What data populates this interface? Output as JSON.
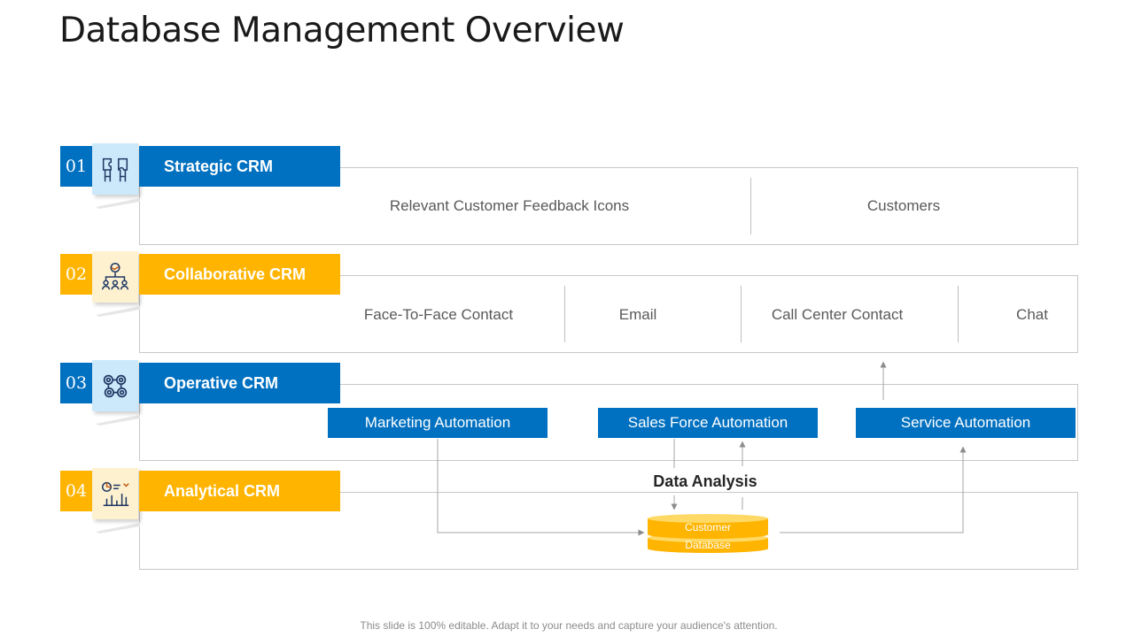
{
  "title": "Database Management Overview",
  "sections": [
    {
      "number": "01",
      "label": "Strategic CRM",
      "color": "#0070c0",
      "icon": "puzzle-people-icon"
    },
    {
      "number": "02",
      "label": "Collaborative  CRM",
      "color": "#ffb400",
      "icon": "team-handshake-icon"
    },
    {
      "number": "03",
      "label": "Operative CRM",
      "color": "#0070c0",
      "icon": "gears-icon"
    },
    {
      "number": "04",
      "label": "Analytical  CRM",
      "color": "#ffb400",
      "icon": "analytics-chart-icon"
    }
  ],
  "strategic_cells": [
    "Relevant Customer Feedback Icons",
    "Customers"
  ],
  "collaborative_cells": [
    "Face-To-Face Contact",
    "Email",
    "Call Center Contact",
    "Chat"
  ],
  "automation_boxes": [
    "Marketing Automation",
    "Sales Force Automation",
    "Service Automation"
  ],
  "analysis": {
    "label": "Data Analysis",
    "database_line1": "Customer",
    "database_line2": "Database"
  },
  "footer": "This slide is 100% editable. Adapt it to your needs and capture your audience's attention.",
  "colors": {
    "blue": "#0070c0",
    "yellow": "#ffb400",
    "light_blue": "#cce8fb",
    "light_yellow": "#fdf1d0"
  }
}
